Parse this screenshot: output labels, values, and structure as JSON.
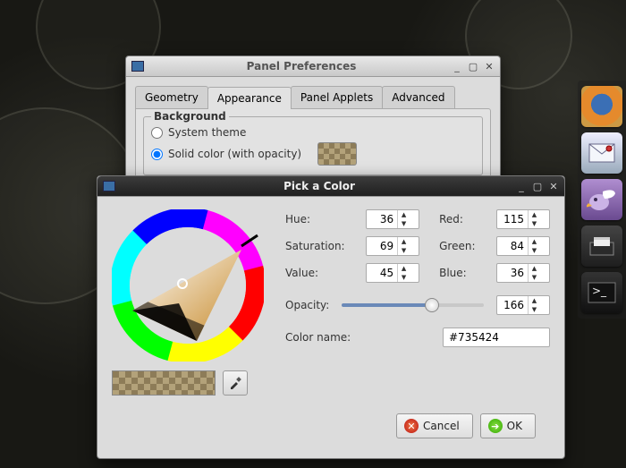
{
  "prefs_window": {
    "title": "Panel Preferences",
    "tabs": [
      "Geometry",
      "Appearance",
      "Panel Applets",
      "Advanced"
    ],
    "active_tab": 1,
    "group_label": "Background",
    "radio_system": "System theme",
    "radio_solid": "Solid color (with opacity)"
  },
  "color_window": {
    "title": "Pick a Color",
    "labels": {
      "hue": "Hue:",
      "sat": "Saturation:",
      "val": "Value:",
      "red": "Red:",
      "green": "Green:",
      "blue": "Blue:",
      "opacity": "Opacity:",
      "colorname": "Color name:"
    },
    "values": {
      "hue": "36",
      "sat": "69",
      "val": "45",
      "red": "115",
      "green": "84",
      "blue": "36",
      "opacity": "166",
      "hex": "#735424"
    },
    "buttons": {
      "cancel": "Cancel",
      "ok": "OK"
    }
  },
  "dock": {
    "items": [
      {
        "name": "firefox-icon"
      },
      {
        "name": "mail-icon"
      },
      {
        "name": "pidgin-icon"
      },
      {
        "name": "files-icon"
      },
      {
        "name": "terminal-icon"
      }
    ]
  }
}
